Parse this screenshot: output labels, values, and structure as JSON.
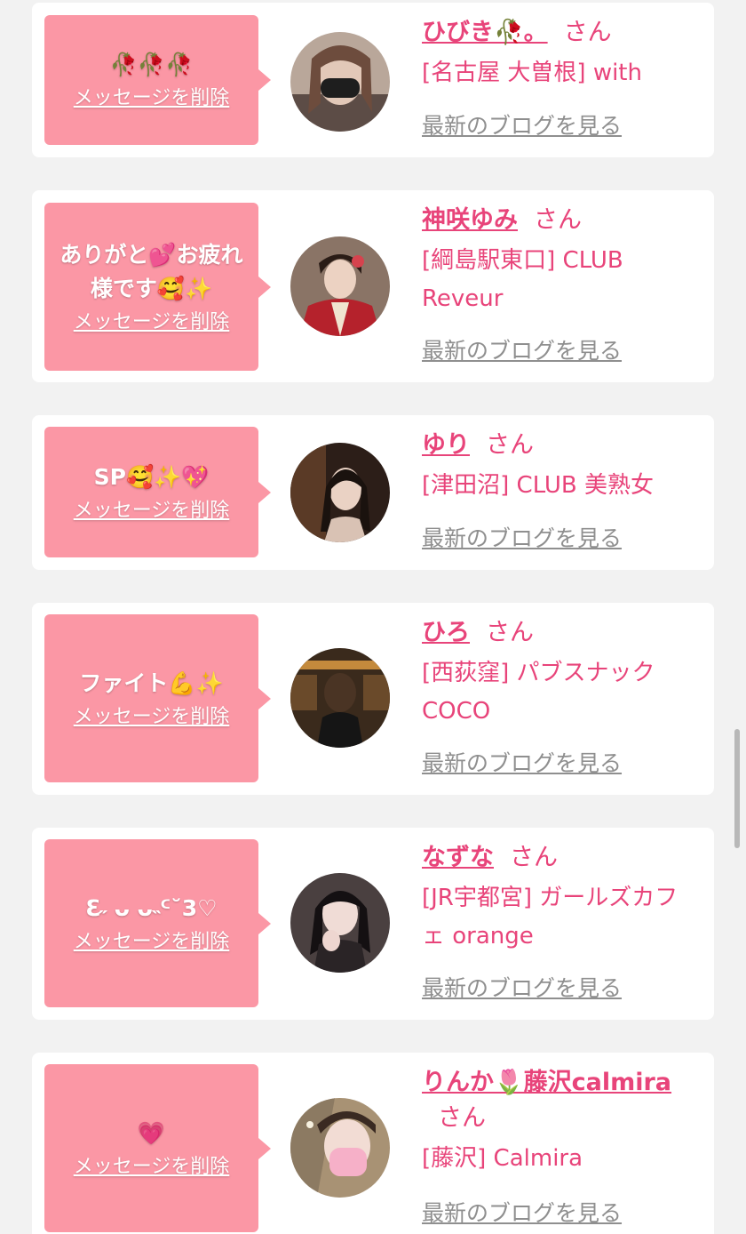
{
  "delete_label": "メッセージを削除",
  "blog_label": "最新のブログを見る",
  "honorific": "さん",
  "colors": {
    "bubble": "#fb97a5",
    "accent": "#e8447a",
    "link_gray": "#8f8f8f",
    "background": "#f2f2f2"
  },
  "items": [
    {
      "message": "🥀🥀🥀",
      "name": "ひびき🥀。",
      "shop": "[名古屋 大曽根] with",
      "avatar_icon": "woman-masked-photo"
    },
    {
      "message": "ありがと💕お疲れ様です🥰✨",
      "name": "神咲ゆみ",
      "shop": "[綱島駅東口] CLUB Reveur",
      "avatar_icon": "woman-kimono-photo"
    },
    {
      "message": "SP🥰✨💖",
      "name": "ゆり",
      "shop": "[津田沼] CLUB 美熟女",
      "avatar_icon": "woman-dark-photo"
    },
    {
      "message": "ファイト💪✨",
      "name": "ひろ",
      "shop": "[西荻窪] パブスナック COCO",
      "avatar_icon": "woman-back-photo"
    },
    {
      "message": "ℇ˶ ᴗ ᴗ˵ᑦ˘3♡",
      "name": "なずな",
      "shop": "[JR宇都宮] ガールズカフェ orange",
      "avatar_icon": "woman-pose-photo"
    },
    {
      "message": "💗",
      "name": "りんか🌷藤沢calmira",
      "shop": "[藤沢] Calmira",
      "avatar_icon": "woman-masked-photo"
    }
  ]
}
